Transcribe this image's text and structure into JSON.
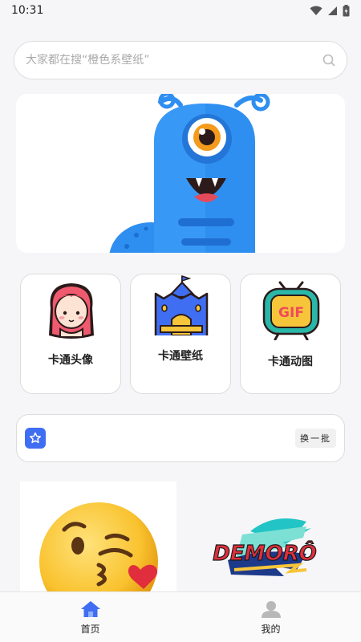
{
  "status": {
    "time": "10:31",
    "wifi_icon": "wifi-icon",
    "signal_icon": "signal-icon",
    "battery_icon": "battery-charging-icon"
  },
  "search": {
    "placeholder": "大家都在搜“橙色系壁纸”",
    "icon": "search-icon"
  },
  "categories": [
    {
      "label": "卡通头像",
      "icon": "girl-avatar-icon"
    },
    {
      "label": "卡通壁纸",
      "icon": "castle-icon"
    },
    {
      "label": "卡通动图",
      "icon": "gif-tv-icon"
    }
  ],
  "refresh": {
    "icon": "star-badge-icon",
    "button_label": "换一批"
  },
  "feed": [
    {
      "icon": "kissing-emoji-icon"
    },
    {
      "sticker_text": "DEMORÔ"
    }
  ],
  "tabbar": {
    "items": [
      {
        "label": "首页",
        "icon": "home-icon",
        "active": true
      },
      {
        "label": "我的",
        "icon": "user-icon",
        "active": false
      }
    ]
  },
  "colors": {
    "accent": "#3f6ef2",
    "background": "#f6f6f8",
    "monster_blue": "#2f8ff0"
  }
}
